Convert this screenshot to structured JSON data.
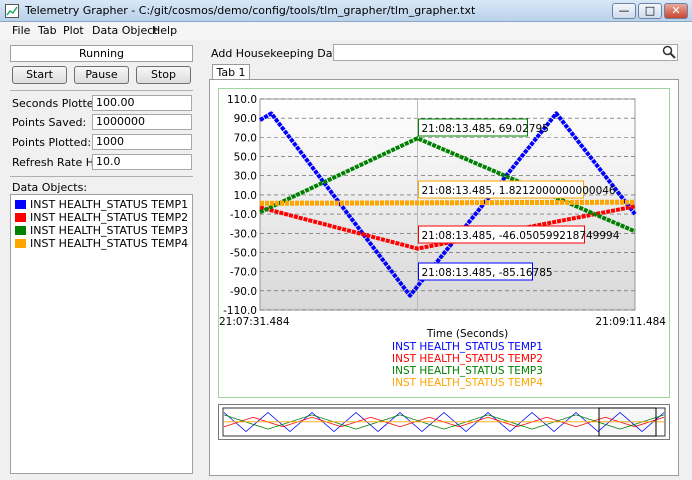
{
  "window": {
    "title": "Telemetry Grapher - C:/git/cosmos/demo/config/tools/tlm_grapher/tlm_grapher.txt",
    "minimize_glyph": "—",
    "maximize_glyph": "□",
    "close_glyph": "✕"
  },
  "menu": [
    "File",
    "Tab",
    "Plot",
    "Data Object",
    "Help"
  ],
  "status": "Running",
  "controls": {
    "start": "Start",
    "pause": "Pause",
    "stop": "Stop"
  },
  "stats": [
    {
      "label": "Seconds Plotted:",
      "value": "100.00"
    },
    {
      "label": "Points Saved:",
      "value": "1000000"
    },
    {
      "label": "Points Plotted:",
      "value": "1000"
    },
    {
      "label": "Refresh Rate Hz:",
      "value": "10.0"
    }
  ],
  "data_objects_label": "Data Objects:",
  "data_objects": [
    {
      "name": "INST HEALTH_STATUS TEMP1",
      "color": "#0000ff"
    },
    {
      "name": "INST HEALTH_STATUS TEMP2",
      "color": "#ff0000"
    },
    {
      "name": "INST HEALTH_STATUS TEMP3",
      "color": "#008000"
    },
    {
      "name": "INST HEALTH_STATUS TEMP4",
      "color": "#ffa500"
    }
  ],
  "add_hk_label": "Add Housekeeping Data Object:",
  "search_value": "",
  "search_icon": "magnifier-icon",
  "tabs": [
    {
      "label": "Tab 1"
    }
  ],
  "chart_data": {
    "type": "line",
    "xlabel": "Time (Seconds)",
    "x_start_label": "21:07:31.484",
    "x_end_label": "21:09:11.484",
    "xlim": [
      0,
      100
    ],
    "ylim": [
      -110,
      110
    ],
    "y_ticks": [
      "110.0",
      "90.0",
      "70.0",
      "50.0",
      "30.0",
      "10.0",
      "-10.0",
      "-30.0",
      "-50.0",
      "-70.0",
      "-90.0",
      "-110.0"
    ],
    "grid": true,
    "cursor_x": 42,
    "series": [
      {
        "name": "INST HEALTH_STATUS TEMP1",
        "color": "#0000ff",
        "points": [
          [
            0,
            88
          ],
          [
            3,
            95
          ],
          [
            40,
            -95
          ],
          [
            79,
            95
          ],
          [
            100,
            -10
          ]
        ]
      },
      {
        "name": "INST HEALTH_STATUS TEMP2",
        "color": "#ff0000",
        "points": [
          [
            0,
            -3
          ],
          [
            42,
            -46
          ],
          [
            100,
            -2
          ]
        ]
      },
      {
        "name": "INST HEALTH_STATUS TEMP3",
        "color": "#008000",
        "points": [
          [
            0,
            -8
          ],
          [
            42,
            69
          ],
          [
            100,
            -28
          ]
        ]
      },
      {
        "name": "INST HEALTH_STATUS TEMP4",
        "color": "#ffa500",
        "points": [
          [
            0,
            1.2
          ],
          [
            100,
            2.4
          ]
        ]
      }
    ],
    "annotations": [
      {
        "text": "21:08:13.485, 69.02795",
        "color": "#008000"
      },
      {
        "text": "21:08:13.485, 1.8212000000000046",
        "color": "#ffa500"
      },
      {
        "text": "21:08:13.485, -46.050599218749994",
        "color": "#ff0000"
      },
      {
        "text": "21:08:13.485, -85.16785",
        "color": "#0000ff"
      }
    ],
    "legend": [
      {
        "name": "INST HEALTH_STATUS TEMP1",
        "color": "#0000ff"
      },
      {
        "name": "INST HEALTH_STATUS TEMP2",
        "color": "#ff0000"
      },
      {
        "name": "INST HEALTH_STATUS TEMP3",
        "color": "#008000"
      },
      {
        "name": "INST HEALTH_STATUS TEMP4",
        "color": "#ffa500"
      }
    ]
  }
}
